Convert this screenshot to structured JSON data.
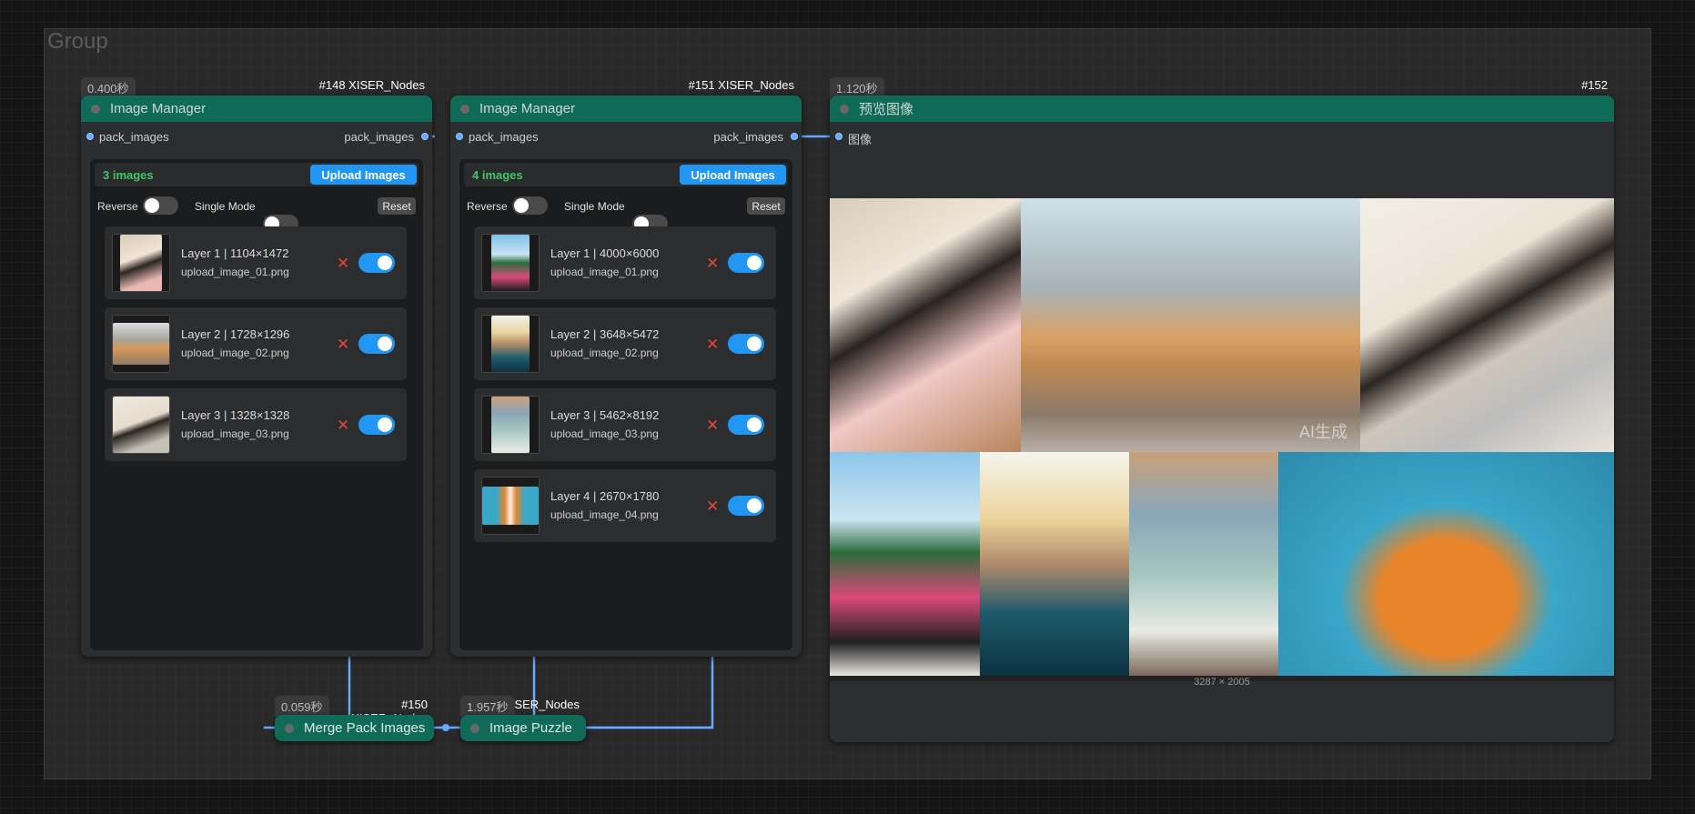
{
  "group": {
    "title": "Group"
  },
  "node148": {
    "timing": "0.400秒",
    "id": "#148 XISER_Nodes",
    "title": "Image Manager",
    "input_label": "pack_images",
    "output_label": "pack_images",
    "count_text": "3 images",
    "upload_label": "Upload Images",
    "reverse_label": "Reverse",
    "single_mode_label": "Single Mode",
    "reset_label": "Reset",
    "reverse_on": false,
    "single_mode_on": false,
    "layers": [
      {
        "name": "Layer 1 | 1104×1472",
        "file": "upload_image_01.png",
        "enabled": true
      },
      {
        "name": "Layer 2 | 1728×1296",
        "file": "upload_image_02.png",
        "enabled": true
      },
      {
        "name": "Layer 3 | 1328×1328",
        "file": "upload_image_03.png",
        "enabled": true
      }
    ]
  },
  "node151": {
    "timing": "",
    "id": "#151 XISER_Nodes",
    "title": "Image Manager",
    "input_label": "pack_images",
    "output_label": "pack_images",
    "count_text": "4 images",
    "upload_label": "Upload Images",
    "reverse_label": "Reverse",
    "single_mode_label": "Single Mode",
    "reset_label": "Reset",
    "reverse_on": false,
    "single_mode_on": false,
    "layers": [
      {
        "name": "Layer 1 | 4000×6000",
        "file": "upload_image_01.png",
        "enabled": true
      },
      {
        "name": "Layer 2 | 3648×5472",
        "file": "upload_image_02.png",
        "enabled": true
      },
      {
        "name": "Layer 3 | 5462×8192",
        "file": "upload_image_03.png",
        "enabled": true
      },
      {
        "name": "Layer 4 | 2670×1780",
        "file": "upload_image_04.png",
        "enabled": true
      }
    ]
  },
  "node152": {
    "timing": "1.120秒",
    "id": "#152",
    "title": "预览图像",
    "input_label": "图像",
    "watermark": "AI生成",
    "image_dims": "3287 × 2005"
  },
  "node150": {
    "timing": "0.059秒",
    "id": "#150 XISER_Nodes",
    "title": "Merge Pack Images"
  },
  "node_puzzle": {
    "timing": "1.957秒",
    "id": "SER_Nodes",
    "title": "Image Puzzle"
  },
  "colors": {
    "node_header": "#0f6b58",
    "accent_blue": "#2196f3",
    "count_green": "#3fc766",
    "delete_red": "#e5483b",
    "link_blue": "#66aaff"
  },
  "icons": [
    "node-status-dot-icon",
    "delete-x-icon",
    "slot-dot-icon"
  ]
}
